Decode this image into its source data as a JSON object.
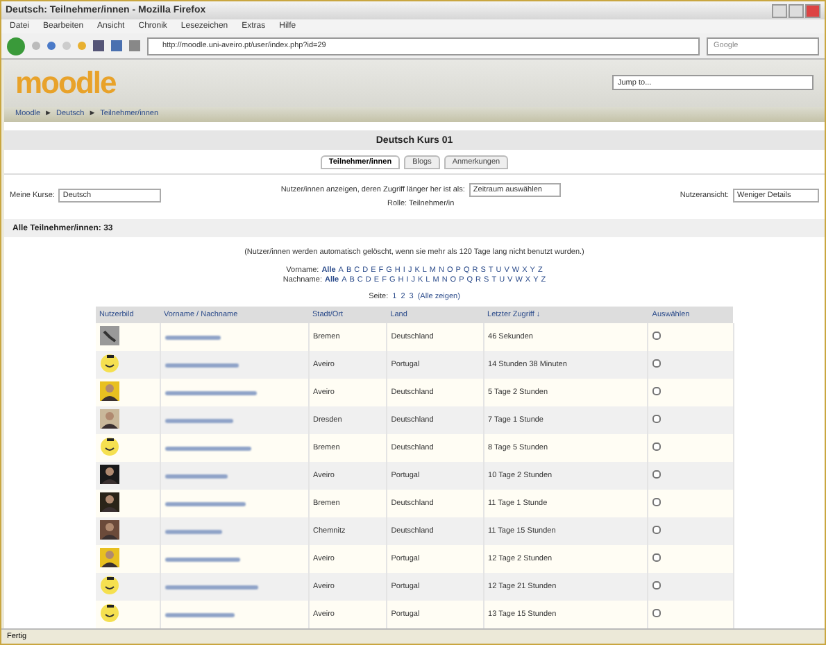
{
  "window": {
    "title": "Deutsch: Teilnehmer/innen - Mozilla Firefox"
  },
  "menu": [
    "Datei",
    "Bearbeiten",
    "Ansicht",
    "Chronik",
    "Lesezeichen",
    "Extras",
    "Hilfe"
  ],
  "address": "http://moodle.uni-aveiro.pt/user/index.php?id=29",
  "search_engine": "Google",
  "jump_select": "Jump to...",
  "logo": "moodle",
  "breadcrumb_separator": "►",
  "breadcrumb": [
    "Moodle",
    "Deutsch",
    "Teilnehmer/innen"
  ],
  "course_title": "Deutsch Kurs 01",
  "tabs": [
    {
      "label": "Teilnehmer/innen",
      "selected": true
    },
    {
      "label": "Blogs",
      "selected": false
    },
    {
      "label": "Anmerkungen",
      "selected": false
    }
  ],
  "filters": {
    "course_label": "Meine Kurse:",
    "course_value": "Deutsch",
    "inactive_label": "Nutzer/innen anzeigen, deren Zugriff länger her ist als:",
    "inactive_value": "Zeitraum auswählen",
    "role": "Rolle: Teilnehmer/in",
    "view_label": "Nutzeransicht:",
    "view_value": "Weniger Details"
  },
  "count": "Alle Teilnehmer/innen: 33",
  "note": "(Nutzer/innen werden automatisch gelöscht, wenn sie mehr als 120 Tage lang nicht benutzt wurden.)",
  "initials": [
    {
      "label": "Vorname:",
      "all": "Alle",
      "letters": [
        "A",
        "B",
        "C",
        "D",
        "E",
        "F",
        "G",
        "H",
        "I",
        "J",
        "K",
        "L",
        "M",
        "N",
        "O",
        "P",
        "Q",
        "R",
        "S",
        "T",
        "U",
        "V",
        "W",
        "X",
        "Y",
        "Z"
      ]
    },
    {
      "label": "Nachname:",
      "all": "Alle",
      "letters": [
        "A",
        "B",
        "C",
        "D",
        "E",
        "F",
        "G",
        "H",
        "I",
        "J",
        "K",
        "L",
        "M",
        "N",
        "O",
        "P",
        "Q",
        "R",
        "S",
        "T",
        "U",
        "V",
        "W",
        "X",
        "Y",
        "Z"
      ]
    }
  ],
  "paging": {
    "label": "Seite:",
    "pages": [
      "1",
      "2",
      "3"
    ],
    "all": "(Alle zeigen)"
  },
  "table": {
    "columns": [
      "Nutzerbild",
      "Vorname / Nachname",
      "Stadt/Ort",
      "Land",
      "Letzter Zugriff ↓",
      "Auswählen"
    ],
    "rows": [
      {
        "kind": "icon",
        "city": "Bremen",
        "country": "Deutschland",
        "last": "46 Sekunden",
        "checked": false
      },
      {
        "kind": "smiley",
        "city": "Aveiro",
        "country": "Portugal",
        "last": "14 Stunden 38 Minuten",
        "checked": false
      },
      {
        "kind": "picture",
        "city": "Aveiro",
        "country": "Deutschland",
        "last": "5 Tage 2 Stunden",
        "checked": false
      },
      {
        "kind": "picture",
        "city": "Dresden",
        "country": "Deutschland",
        "last": "7 Tage 1 Stunde",
        "checked": false
      },
      {
        "kind": "smiley",
        "city": "Bremen",
        "country": "Deutschland",
        "last": "8 Tage 5 Stunden",
        "checked": false
      },
      {
        "kind": "picture",
        "city": "Aveiro",
        "country": "Portugal",
        "last": "10 Tage 2 Stunden",
        "checked": false
      },
      {
        "kind": "picture",
        "city": "Bremen",
        "country": "Deutschland",
        "last": "11 Tage 1 Stunde",
        "checked": false
      },
      {
        "kind": "picture",
        "city": "Chemnitz",
        "country": "Deutschland",
        "last": "11 Tage 15 Stunden",
        "checked": false
      },
      {
        "kind": "picture",
        "city": "Aveiro",
        "country": "Portugal",
        "last": "12 Tage 2 Stunden",
        "checked": false
      },
      {
        "kind": "smiley",
        "city": "Aveiro",
        "country": "Portugal",
        "last": "12 Tage 21 Stunden",
        "checked": false
      },
      {
        "kind": "smiley",
        "city": "Aveiro",
        "country": "Portugal",
        "last": "13 Tage 15 Stunden",
        "checked": false
      }
    ]
  },
  "status": "Fertig"
}
